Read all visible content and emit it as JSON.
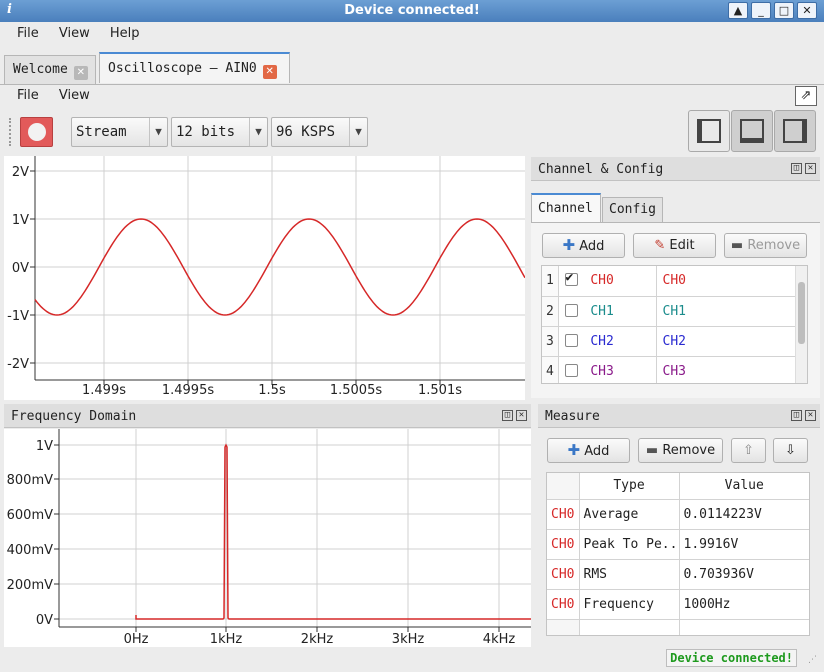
{
  "window": {
    "title": "Device connected!",
    "app_icon": "i",
    "controls": [
      "▲",
      "_",
      "□",
      "✕"
    ]
  },
  "menu": [
    "File",
    "View",
    "Help"
  ],
  "tabs": [
    {
      "label": "Welcome",
      "active": false
    },
    {
      "label": "Oscilloscope – AIN0",
      "active": true
    }
  ],
  "submenu": [
    "File",
    "View"
  ],
  "toolbar": {
    "mode": "Stream",
    "resolution": "12 bits",
    "rate": "96 KSPS"
  },
  "time_plot": {
    "yticks": [
      "2V",
      "1V",
      "0V",
      "-1V",
      "-2V"
    ],
    "xticks": [
      "1.499s",
      "1.4995s",
      "1.5s",
      "1.5005s",
      "1.501s"
    ]
  },
  "freq_panel": {
    "title": "Frequency Domain",
    "yticks": [
      "1V",
      "800mV",
      "600mV",
      "400mV",
      "200mV",
      "0V"
    ],
    "xticks": [
      "0Hz",
      "1kHz",
      "2kHz",
      "3kHz",
      "4kHz"
    ]
  },
  "channel_panel": {
    "title": "Channel & Config",
    "tabs": [
      "Channel",
      "Config"
    ],
    "buttons": {
      "add": "Add",
      "edit": "Edit",
      "remove": "Remove"
    },
    "rows": [
      {
        "num": "1",
        "checked": true,
        "name": "CH0",
        "label": "CH0",
        "color": "#d62828"
      },
      {
        "num": "2",
        "checked": false,
        "name": "CH1",
        "label": "CH1",
        "color": "#1b8c8c"
      },
      {
        "num": "3",
        "checked": false,
        "name": "CH2",
        "label": "CH2",
        "color": "#2a2ad0"
      },
      {
        "num": "4",
        "checked": false,
        "name": "CH3",
        "label": "CH3",
        "color": "#8a1a8a"
      }
    ]
  },
  "measure_panel": {
    "title": "Measure",
    "buttons": {
      "add": "Add",
      "remove": "Remove"
    },
    "headers": [
      "Type",
      "Value"
    ],
    "rows": [
      {
        "ch": "CH0",
        "type": "Average",
        "value": "0.0114223V"
      },
      {
        "ch": "CH0",
        "type": "Peak To Pe..",
        "value": "1.9916V"
      },
      {
        "ch": "CH0",
        "type": "RMS",
        "value": "0.703936V"
      },
      {
        "ch": "CH0",
        "type": "Frequency",
        "value": "1000Hz"
      }
    ]
  },
  "status": "Device connected!",
  "colors": {
    "trace": "#d62828",
    "accent": "#4a8ad3"
  }
}
